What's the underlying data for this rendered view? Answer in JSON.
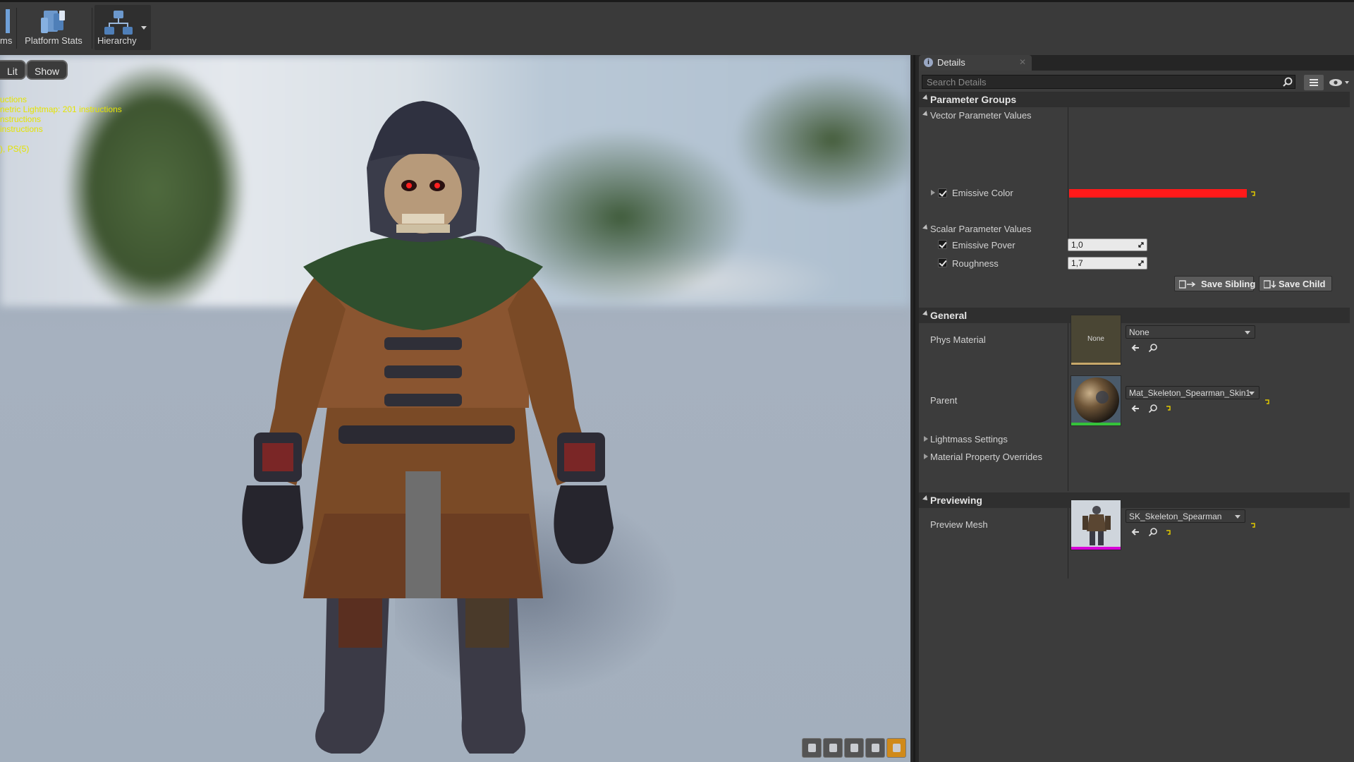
{
  "toolbar": {
    "partial_label": "ms",
    "platform_stats_label": "Platform Stats",
    "hierarchy_label": "Hierarchy"
  },
  "viewport": {
    "lit_label": "Lit",
    "show_label": "Show",
    "stats_lines": [
      "uctions",
      "netric Lightmap: 201 instructions",
      "nstructions",
      " instructions",
      "",
      "), PS(5)"
    ]
  },
  "details": {
    "tab_label": "Details",
    "search_placeholder": "Search Details",
    "parameter_groups": {
      "header": "Parameter Groups",
      "vector_header": "Vector Parameter Values",
      "emissive_color_label": "Emissive Color",
      "emissive_color": "#ff1a1a",
      "scalar_header": "Scalar Parameter Values",
      "emissive_power_label": "Emissive Pover",
      "emissive_power_value": "1,0",
      "roughness_label": "Roughness",
      "roughness_value": "1,7",
      "save_sibling_label": "Save Sibling",
      "save_child_label": "Save Child"
    },
    "general": {
      "header": "General",
      "phys_material_label": "Phys Material",
      "phys_thumb_text": "None",
      "phys_combo_value": "None",
      "parent_label": "Parent",
      "parent_combo_value": "Mat_Skeleton_Spearman_Skin1",
      "lightmass_label": "Lightmass Settings",
      "material_overrides_label": "Material Property Overrides"
    },
    "previewing": {
      "header": "Previewing",
      "preview_mesh_label": "Preview Mesh",
      "preview_combo_value": "SK_Skeleton_Spearman"
    }
  },
  "colors": {
    "stats_text": "#e4e400",
    "accent_orange": "#d08a1a",
    "thumb_green_bar": "#35c23a",
    "thumb_magenta_bar": "#d800d8",
    "thumb_gold_bar": "#c8a86a",
    "reset_arrow": "#e0c800"
  }
}
